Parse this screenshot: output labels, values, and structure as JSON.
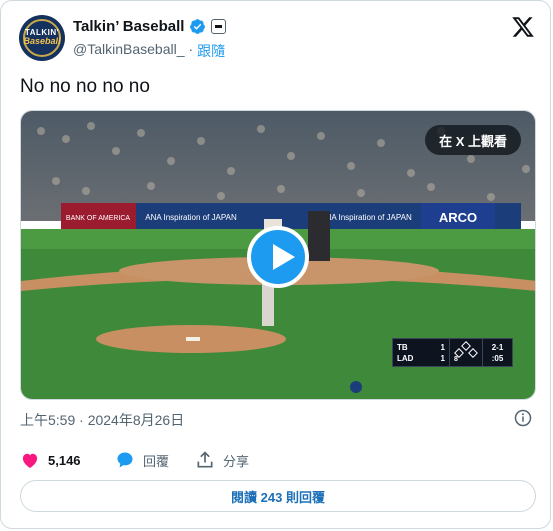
{
  "author": {
    "display_name": "Talkin’ Baseball",
    "handle": "@TalkinBaseball_",
    "separator": "·",
    "follow_label": "跟隨",
    "avatar_text_top": "TALKIN'",
    "avatar_text_bottom": "Baseball",
    "verified_icon": "verified-badge-icon",
    "affiliate_icon": "affiliate-badge-icon"
  },
  "platform_logo": "x-logo-icon",
  "tweet": {
    "text": "No no no no no"
  },
  "media": {
    "watch_on_x_label": "在 X 上觀看",
    "play_icon": "play-icon",
    "scorebug": {
      "team1": "TB",
      "score1": "1",
      "team2": "LAD",
      "score2": "1",
      "inning": "8",
      "count": "2-1",
      "clock": ":05"
    },
    "signage": [
      "BANK OF AMERICA",
      "ANA Inspiration of JAPAN",
      "ANA Inspiration of JAPAN",
      "ARCO"
    ]
  },
  "timestamp": "上午5:59 · 2024年8月26日",
  "info_icon": "info-icon",
  "actions": {
    "likes_count": "5,146",
    "reply_label": "回覆",
    "share_label": "分享"
  },
  "read_replies_label": "閱讀 243 則回覆",
  "colors": {
    "accent": "#1d9bf0",
    "like": "#f91880",
    "text_secondary": "#536471",
    "border": "#cfd9de"
  }
}
